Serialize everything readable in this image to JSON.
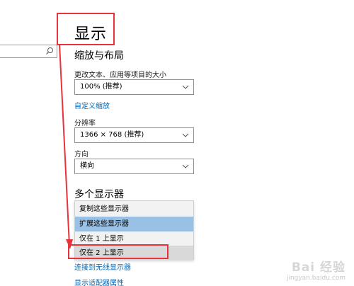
{
  "page": {
    "title": "显示"
  },
  "search": {
    "value": ""
  },
  "scale_section": {
    "title": "缩放与布局",
    "text_size_label": "更改文本、应用等项目的大小",
    "text_size_value": "100% (推荐)",
    "custom_scaling_link": "自定义缩放",
    "resolution_label": "分辨率",
    "resolution_value": "1366 × 768 (推荐)",
    "orientation_label": "方向",
    "orientation_value": "横向"
  },
  "multi_display": {
    "title": "多个显示器",
    "options": [
      {
        "label": "复制这些显示器",
        "state": "normal"
      },
      {
        "label": "扩展这些显示器",
        "state": "highlighted"
      },
      {
        "label": "仅在 1 上显示",
        "state": "normal"
      },
      {
        "label": "仅在 2 上显示",
        "state": "selected"
      }
    ],
    "connect_wireless_link": "连接到无线显示器",
    "adapter_properties_link": "显示适配器属性"
  },
  "watermark": {
    "logo": "Bai 经验",
    "url": "jingyan.baidu.com"
  },
  "colors": {
    "link": "#0066b4",
    "highlight": "#99c1e6",
    "selected": "#d9d9d9",
    "annotation": "#e8323c"
  },
  "icons": [
    "search-icon",
    "chevron-down-icon"
  ]
}
